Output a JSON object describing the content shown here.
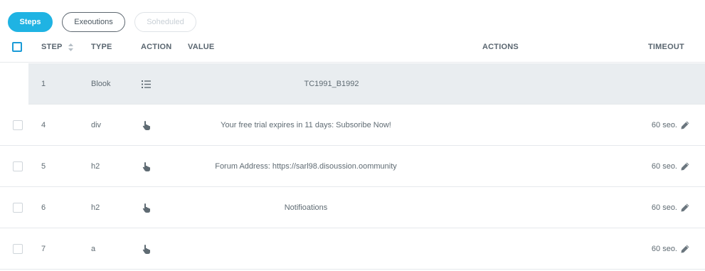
{
  "tabs": [
    {
      "label": "Steps",
      "state": "active"
    },
    {
      "label": "Exeoutions",
      "state": "normal"
    },
    {
      "label": "Soheduled",
      "state": "disabled"
    }
  ],
  "columns": {
    "step": "STEP",
    "type": "TYPE",
    "action": "ACTION",
    "value": "VALUE",
    "actions": "ACTIONS",
    "timeout": "TIMEOUT"
  },
  "rows": [
    {
      "step": "1",
      "type": "Blook",
      "action_icon": "list-icon",
      "value": "TC1991_B1992",
      "timeout": "",
      "is_block": true
    },
    {
      "step": "4",
      "type": "div",
      "action_icon": "hand-pointer-icon",
      "value": "Your free trial expires in 11 days: Subsoribe Now!",
      "timeout": "60 seo."
    },
    {
      "step": "5",
      "type": "h2",
      "action_icon": "hand-pointer-icon",
      "value": "Forum Address: https://sarl98.disoussion.oommunity",
      "timeout": "60 seo."
    },
    {
      "step": "6",
      "type": "h2",
      "action_icon": "hand-pointer-icon",
      "value": "Notifioations",
      "timeout": "60 seo."
    },
    {
      "step": "7",
      "type": "a",
      "action_icon": "hand-pointer-icon",
      "value": "",
      "timeout": "60 seo."
    }
  ],
  "colors": {
    "accent": "#1fb3e3",
    "checkbox_accent": "#1a9bd7",
    "block_row_bg": "#e9edf0",
    "text": "#5f6b73"
  }
}
